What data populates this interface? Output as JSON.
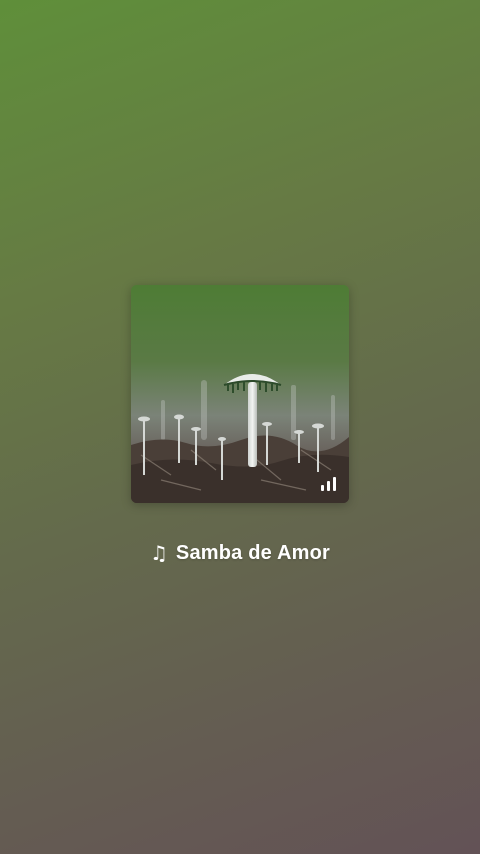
{
  "now_playing": {
    "title": "Samba de Amor",
    "title_icon": "music-note-icon",
    "playing_indicator_icon": "equalizer-bars-icon"
  },
  "colors": {
    "background_top": "#5f8f3a",
    "background_bottom": "#635256",
    "text": "#ffffff"
  }
}
